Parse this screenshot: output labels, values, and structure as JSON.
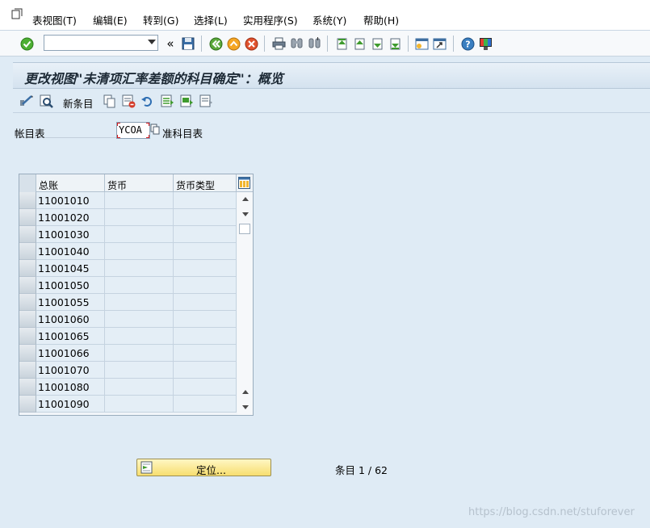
{
  "menu": {
    "items": [
      "表视图(T)",
      "编辑(E)",
      "转到(G)",
      "选择(L)",
      "实用程序(S)",
      "系统(Y)",
      "帮助(H)"
    ]
  },
  "toolbar": {
    "command_value": "",
    "collapse_label": "«"
  },
  "title": "更改视图\"未清项汇率差额的科目确定\"：概览",
  "app_toolbar": {
    "new_entries_label": "新条目"
  },
  "field": {
    "label": "帐目表",
    "value": "YCOA",
    "description": "准科目表"
  },
  "table": {
    "columns": [
      "总账",
      "货币",
      "货币类型"
    ],
    "rows": [
      {
        "account": "11001010",
        "currency": "",
        "currency_type": ""
      },
      {
        "account": "11001020",
        "currency": "",
        "currency_type": ""
      },
      {
        "account": "11001030",
        "currency": "",
        "currency_type": ""
      },
      {
        "account": "11001040",
        "currency": "",
        "currency_type": ""
      },
      {
        "account": "11001045",
        "currency": "",
        "currency_type": ""
      },
      {
        "account": "11001050",
        "currency": "",
        "currency_type": ""
      },
      {
        "account": "11001055",
        "currency": "",
        "currency_type": ""
      },
      {
        "account": "11001060",
        "currency": "",
        "currency_type": ""
      },
      {
        "account": "11001065",
        "currency": "",
        "currency_type": ""
      },
      {
        "account": "11001066",
        "currency": "",
        "currency_type": ""
      },
      {
        "account": "11001070",
        "currency": "",
        "currency_type": ""
      },
      {
        "account": "11001080",
        "currency": "",
        "currency_type": ""
      },
      {
        "account": "11001090",
        "currency": "",
        "currency_type": ""
      }
    ]
  },
  "footer": {
    "position_button": "定位...",
    "entry_label": "条目",
    "entry_current": "1",
    "entry_total": "62",
    "entries_text": "条目 1 / 62"
  },
  "watermark": "https://blog.csdn.net/stuforever"
}
